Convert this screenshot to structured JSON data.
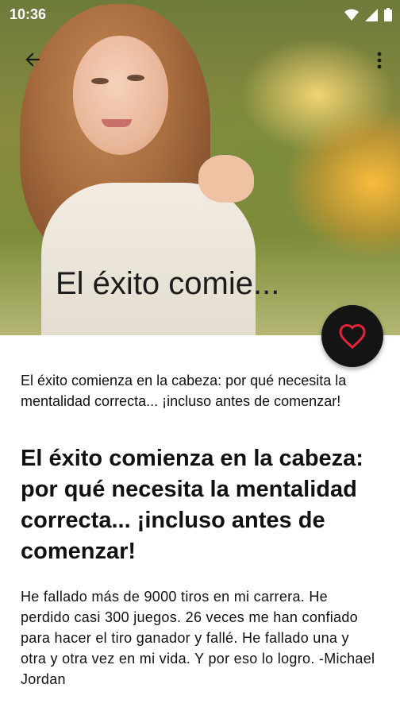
{
  "status_bar": {
    "time": "10:36",
    "icons": [
      "wifi-icon",
      "signal-icon",
      "battery-icon"
    ]
  },
  "toolbar": {
    "back_icon": "arrow-left-icon",
    "menu_icon": "more-vert-icon"
  },
  "hero": {
    "title": "El éxito comie..."
  },
  "fab": {
    "icon": "heart-outline-icon",
    "icon_color": "#e0243a",
    "background": "#141414"
  },
  "article": {
    "subtitle": "El éxito comienza en la cabeza: por qué necesita la mentalidad correcta... ¡incluso antes de comenzar!",
    "headline": "El éxito comienza en la cabeza: por qué necesita la mentalidad correcta... ¡incluso antes de comenzar!",
    "body": "He fallado más de 9000 tiros en mi carrera. He perdido casi 300 juegos. 26 veces me han confiado para hacer el tiro ganador y fallé. He fallado una y otra y otra vez en mi vida. Y por eso lo logro. -Michael Jordan"
  }
}
